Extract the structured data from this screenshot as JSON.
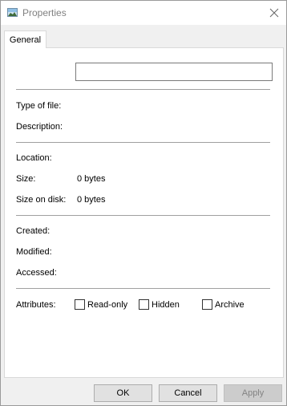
{
  "window": {
    "title": "Properties",
    "icon": "image-file-icon",
    "close_icon": "close-icon"
  },
  "tabs": [
    {
      "label": "General",
      "selected": true
    }
  ],
  "general": {
    "name_value": "",
    "type_label": "Type of file:",
    "type_value": "",
    "description_label": "Description:",
    "description_value": "",
    "location_label": "Location:",
    "location_value": "",
    "size_label": "Size:",
    "size_value": "0 bytes",
    "size_on_disk_label": "Size on disk:",
    "size_on_disk_value": "0 bytes",
    "created_label": "Created:",
    "created_value": "",
    "modified_label": "Modified:",
    "modified_value": "",
    "accessed_label": "Accessed:",
    "accessed_value": "",
    "attributes_label": "Attributes:",
    "attributes": [
      {
        "label": "Read-only",
        "checked": false
      },
      {
        "label": "Hidden",
        "checked": false
      },
      {
        "label": "Archive",
        "checked": false
      }
    ]
  },
  "buttons": {
    "ok": "OK",
    "cancel": "Cancel",
    "apply": "Apply",
    "apply_disabled": true
  }
}
